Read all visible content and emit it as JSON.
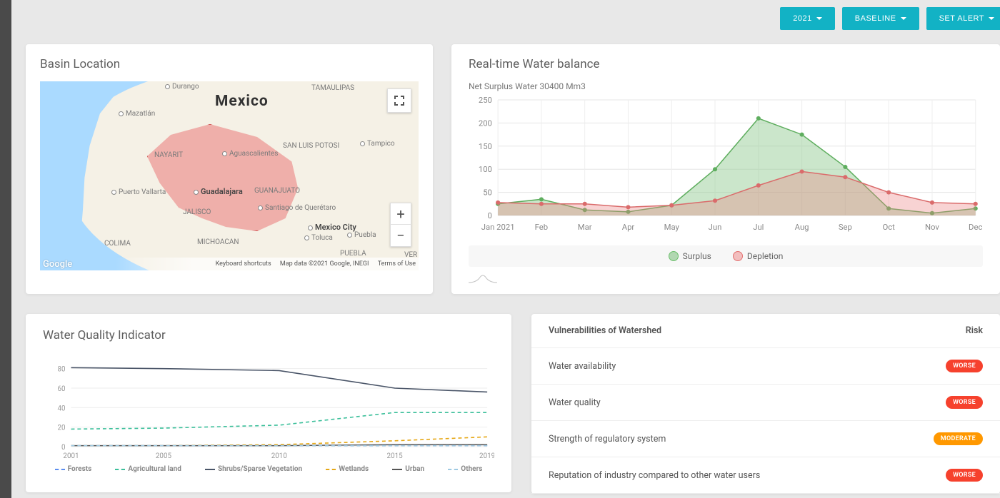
{
  "topbar": {
    "year": "2021",
    "baseline": "BASELINE",
    "alert": "SET ALERT"
  },
  "map_card": {
    "title": "Basin Location",
    "country": "Mexico",
    "labels": {
      "durango": "Durango",
      "tamaulipas": "TAMAULIPAS",
      "mazatlan": "Mazatlán",
      "sanluis": "SAN LUIS POTOSI",
      "tampico": "Tampico",
      "nayarit": "NAYARIT",
      "aguas": "Aguascalientes",
      "pv": "Puerto Vallarta",
      "guadalajara": "Guadalajara",
      "guanajuato": "GUANAJUATO",
      "jalisco": "JALISCO",
      "queretaro": "Santiago de Querétaro",
      "colima": "COLIMA",
      "michoacan": "MICHOACAN",
      "mexicocity": "Mexico City",
      "toluca": "Toluca",
      "puebla": "Puebla",
      "pueblastate": "PUEBLA",
      "ver": "VER"
    },
    "footer": {
      "google": "Google",
      "shortcuts": "Keyboard shortcuts",
      "mapdata": "Map data ©2021 Google, INEGI",
      "terms": "Terms of Use"
    }
  },
  "balance_card": {
    "title": "Real-time Water balance",
    "subtitle": "Net Surplus Water 30400 Mm3",
    "legend": {
      "surplus": "Surplus",
      "depletion": "Depletion"
    }
  },
  "wqi_card": {
    "title": "Water Quality Indicator",
    "legend": {
      "forests": "Forests",
      "agri": "Agricultural land",
      "shrubs": "Shrubs/Sparse Vegetation",
      "wetlands": "Wetlands",
      "urban": "Urban",
      "others": "Others"
    }
  },
  "vuln_card": {
    "head_left": "Vulnerabilities of Watershed",
    "head_right": "Risk",
    "rows": [
      {
        "label": "Water availability",
        "badge": "WORSE",
        "cls": "worse"
      },
      {
        "label": "Water quality",
        "badge": "WORSE",
        "cls": "worse"
      },
      {
        "label": "Strength of regulatory system",
        "badge": "MODERATE",
        "cls": "moderate"
      },
      {
        "label": "Reputation of industry compared to other water users",
        "badge": "WORSE",
        "cls": "worse"
      }
    ]
  },
  "chart_data": [
    {
      "type": "area",
      "title": "Real-time Water balance",
      "subtitle": "Net Surplus Water 30400 Mm3",
      "xlabel": "",
      "ylabel": "",
      "ylim": [
        0,
        250
      ],
      "yticks": [
        0,
        50,
        100,
        150,
        200,
        250
      ],
      "categories": [
        "Jan 2021",
        "Feb",
        "Mar",
        "Apr",
        "May",
        "Jun",
        "Jul",
        "Aug",
        "Sep",
        "Oct",
        "Nov",
        "Dec"
      ],
      "series": [
        {
          "name": "Surplus",
          "color": "#8fcf8f",
          "values": [
            25,
            35,
            12,
            8,
            22,
            100,
            210,
            175,
            105,
            15,
            5,
            15
          ]
        },
        {
          "name": "Depletion",
          "color": "#e98c8c",
          "values": [
            28,
            25,
            25,
            18,
            22,
            32,
            65,
            95,
            83,
            50,
            28,
            25
          ]
        }
      ],
      "legend_position": "bottom"
    },
    {
      "type": "line",
      "title": "Water Quality Indicator",
      "xlabel": "",
      "ylabel": "",
      "ylim": [
        0,
        90
      ],
      "yticks": [
        0,
        20,
        40,
        60,
        80
      ],
      "x": [
        2001,
        2005,
        2010,
        2015,
        2019
      ],
      "series": [
        {
          "name": "Forests",
          "color": "#5b8def",
          "style": "dashed",
          "values": [
            1,
            1,
            1,
            1,
            1
          ]
        },
        {
          "name": "Agricultural land",
          "color": "#3bbf9a",
          "style": "dashed",
          "values": [
            18,
            19,
            22,
            35,
            35
          ]
        },
        {
          "name": "Shrubs/Sparse Vegetation",
          "color": "#4a5568",
          "style": "solid",
          "values": [
            81,
            80,
            78,
            60,
            56
          ]
        },
        {
          "name": "Wetlands",
          "color": "#e6a817",
          "style": "dashed",
          "values": [
            1,
            1,
            2,
            6,
            10
          ]
        },
        {
          "name": "Urban",
          "color": "#555",
          "style": "solid",
          "values": [
            1,
            1,
            1,
            2,
            2
          ]
        },
        {
          "name": "Others",
          "color": "#9ec9e2",
          "style": "dashed",
          "values": [
            1,
            1,
            1,
            1,
            1
          ]
        }
      ],
      "legend_position": "bottom"
    }
  ]
}
